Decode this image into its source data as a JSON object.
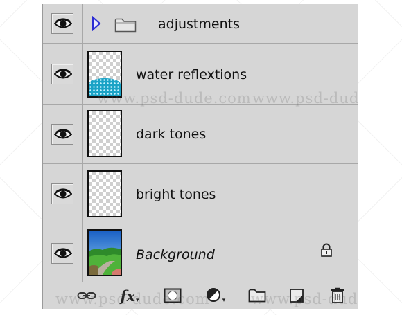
{
  "panel": "layers",
  "watermark_text": "www.psd-dude.com",
  "layers": [
    {
      "name": "adjustments",
      "type": "group",
      "visible": true,
      "expanded": false
    },
    {
      "name": "water reflextions",
      "type": "layer",
      "visible": true
    },
    {
      "name": "dark tones",
      "type": "layer",
      "visible": true
    },
    {
      "name": "bright tones",
      "type": "layer",
      "visible": true
    },
    {
      "name": "Background",
      "type": "background",
      "visible": true,
      "locked": true
    }
  ],
  "toolbar": {
    "fx_label": "fx",
    "icons": [
      "link-layers-icon",
      "layer-style-icon",
      "add-mask-icon",
      "adjustment-layer-icon",
      "new-group-icon",
      "new-layer-icon",
      "delete-layer-icon"
    ]
  },
  "colors": {
    "panel_bg": "#d6d6d6",
    "separator": "#a8a8a8",
    "water": "#1aa3c6",
    "group_triangle": "#2b2bd4"
  }
}
